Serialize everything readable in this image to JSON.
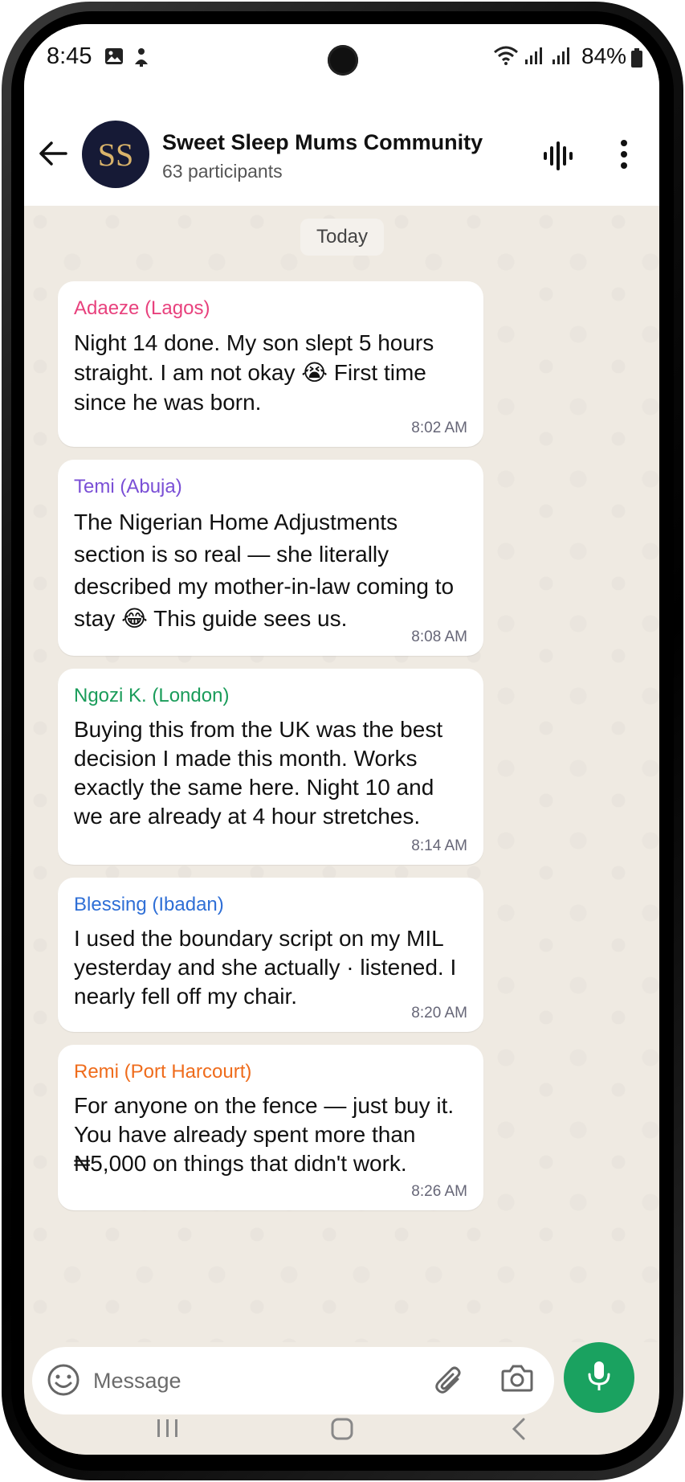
{
  "status_bar": {
    "time": "8:45",
    "battery": "84%",
    "icons": [
      "gallery-icon",
      "notification-icon",
      "wifi-icon",
      "signal-icon",
      "signal-icon",
      "battery-icon"
    ]
  },
  "header": {
    "avatar_text": "SS",
    "title": "Sweet Sleep Mums Community",
    "subtitle": "63 participants"
  },
  "date_chip": "Today",
  "messages": [
    {
      "sender": "Adaeze (Lagos)",
      "sender_color": "#e8417d",
      "text": "Night 14 done. My son slept 5 hours straight. I am not okay 😭 First time since he was born.",
      "time": "8:02 AM"
    },
    {
      "sender": "Temi (Abuja)",
      "sender_color": "#7a4fd6",
      "text": "The Nigerian Home Adjustments section is so real — she literally described my mother-in-law coming to stay 😂 This guide sees us.",
      "time": "8:08 AM"
    },
    {
      "sender": "Ngozi K. (London)",
      "sender_color": "#1a9c5a",
      "text": "Buying this from the UK was the best decision I made this month. Works exactly the same here. Night 10 and we are already at 4 hour stretches.",
      "time": "8:14 AM"
    },
    {
      "sender": "Blessing (Ibadan)",
      "sender_color": "#2f6fd6",
      "text": "I used the boundary script on my MIL yesterday and she actually · listened. I nearly fell off my chair.",
      "time": "8:20 AM"
    },
    {
      "sender": "Remi (Port Harcourt)",
      "sender_color": "#ef6c1c",
      "text": "For anyone on the fence — just buy it. You have already spent more than ₦5,000 on things that didn't work.",
      "time": "8:26 AM"
    }
  ],
  "composer": {
    "placeholder": "Message"
  },
  "colors": {
    "accent": "#1aa260",
    "chat_bg": "#efeae2",
    "avatar_bg": "#161a36",
    "avatar_text": "#d9b36a"
  }
}
